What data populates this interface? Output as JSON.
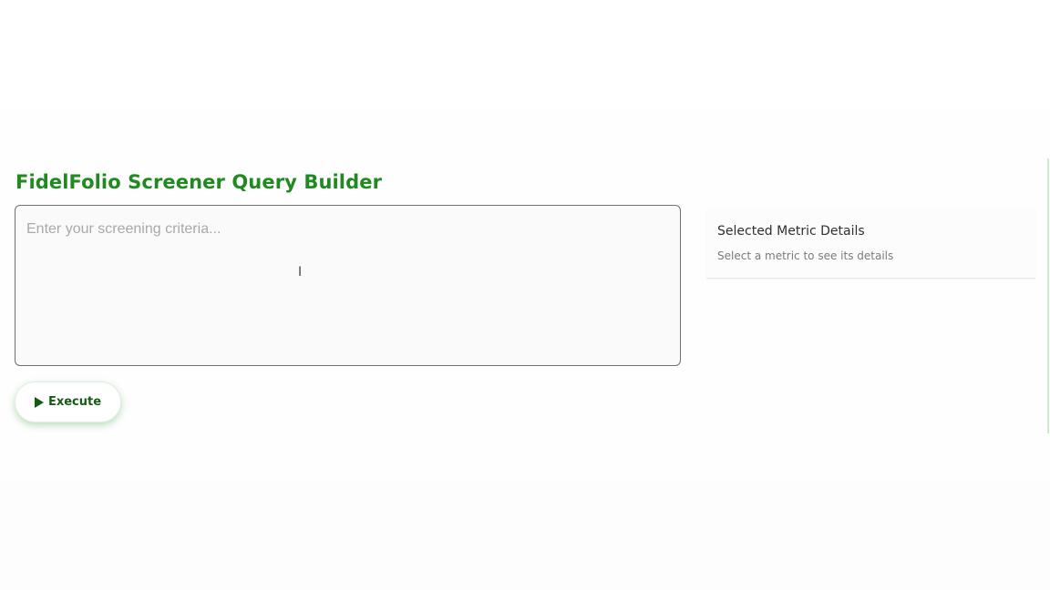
{
  "header": {
    "title": "FidelFolio Screener Query Builder"
  },
  "query": {
    "placeholder": "Enter your screening criteria...",
    "value": ""
  },
  "actions": {
    "execute_label": "Execute",
    "execute_icon": "play-icon"
  },
  "details": {
    "title": "Selected Metric Details",
    "hint": "Select a metric to see its details"
  },
  "colors": {
    "brand_green": "#1f8a1f",
    "button_text": "#145c14",
    "border": "#6f6f6f"
  }
}
